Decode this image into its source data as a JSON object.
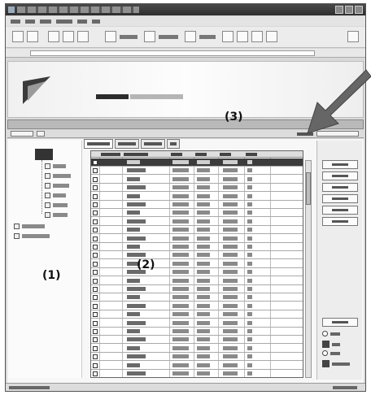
{
  "annotations": {
    "label_1": "(1)",
    "label_2": "(2)",
    "label_3": "(3)"
  },
  "icons": {
    "arrow": "diagonal-arrow-icon",
    "logo": "company-logo"
  },
  "colors": {
    "titlebar": "#3a3a3a",
    "selected_row": "#3c3c3c",
    "arrow": "#666666"
  },
  "grid": {
    "row_count": 26,
    "selected_row_index": 0
  }
}
